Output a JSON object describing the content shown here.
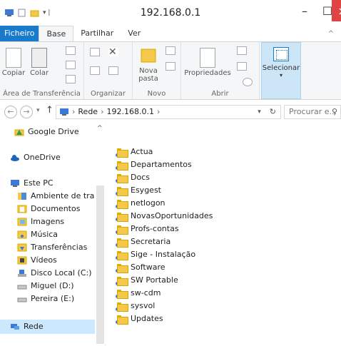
{
  "window": {
    "title": "192.168.0.1"
  },
  "tabs": [
    "Ficheiro",
    "Base",
    "Partilhar",
    "Ver"
  ],
  "ribbon": {
    "clipboard": {
      "copy": "Copiar",
      "paste": "Colar",
      "group": "Área de Transferência"
    },
    "organize": {
      "group": "Organizar"
    },
    "new": {
      "new_folder": "Nova pasta",
      "group": "Novo"
    },
    "open": {
      "properties": "Propriedades",
      "group": "Abrir"
    },
    "select": {
      "label": "Selecionar"
    }
  },
  "address": {
    "path": [
      "Rede",
      "192.168.0.1"
    ],
    "search_placeholder": "Procurar e..."
  },
  "nav": {
    "items": [
      "Google Drive",
      "OneDrive",
      "Este PC",
      "Ambiente de trab",
      "Documentos",
      "Imagens",
      "Música",
      "Transferências",
      "Vídeos",
      "Disco Local (C:)",
      "Miguel (D:)",
      "Pereira (E:)",
      "Rede"
    ]
  },
  "files": [
    "Actua",
    "Departamentos",
    "Docs",
    "Esygest",
    "netlogon",
    "NovasOportunidades",
    "Profs-contas",
    "Secretaria",
    "Sige - Instalação",
    "Software",
    "SW Portable",
    "sw-cdm",
    "sysvol",
    "Updates"
  ],
  "colors": {
    "accent": "#1979ca",
    "folder": "#f4c84a",
    "selection": "#cce8ff",
    "close": "#e04343"
  }
}
